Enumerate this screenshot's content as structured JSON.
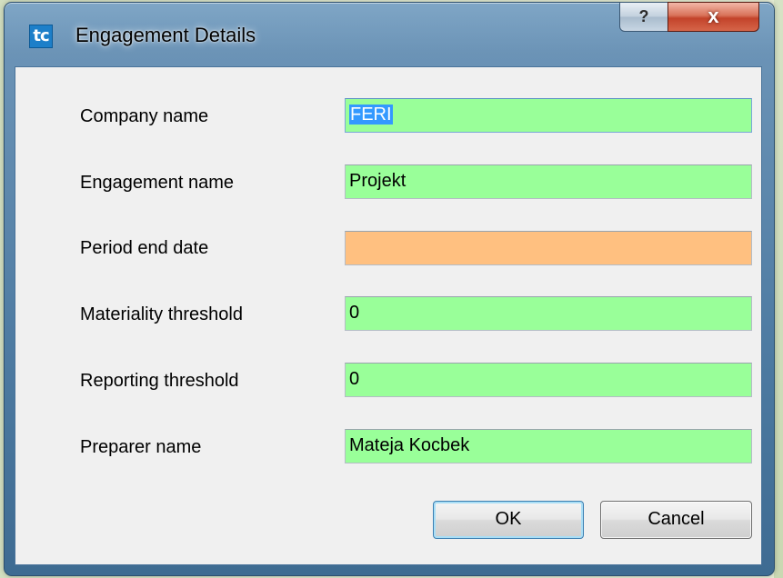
{
  "dialog": {
    "title": "Engagement Details",
    "app_icon_text": "tc",
    "help_button": "?",
    "close_button": "x"
  },
  "form": {
    "fields": [
      {
        "label": "Company name",
        "value": "FERI",
        "status_color": "#99ff99",
        "selected": true
      },
      {
        "label": "Engagement name",
        "value": "Projekt",
        "status_color": "#99ff99"
      },
      {
        "label": "Period end date",
        "value": "",
        "status_color": "#ffc080"
      },
      {
        "label": "Materiality threshold",
        "value": "0",
        "status_color": "#99ff99"
      },
      {
        "label": "Reporting threshold",
        "value": "0",
        "status_color": "#99ff99"
      },
      {
        "label": "Preparer name",
        "value": "Mateja Kocbek",
        "status_color": "#99ff99"
      }
    ]
  },
  "buttons": {
    "ok": "OK",
    "cancel": "Cancel"
  }
}
